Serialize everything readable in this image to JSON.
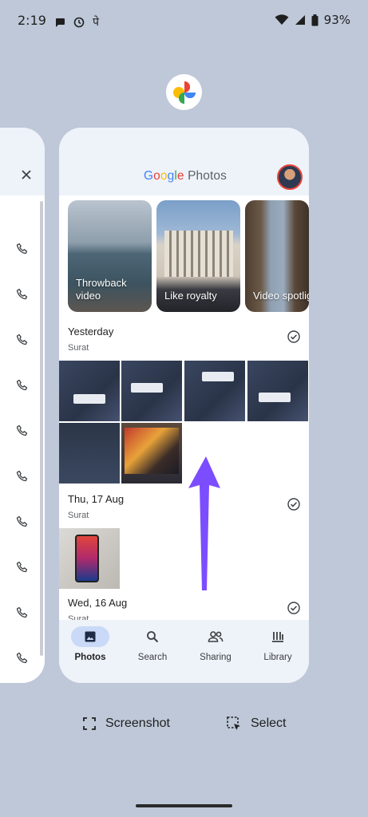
{
  "status_bar": {
    "time": "2:19",
    "battery": "93%",
    "icons": [
      "chat-bubble-icon",
      "clock-icon",
      "devanagari-pe-glyph",
      "wifi-icon",
      "signal-icon",
      "battery-icon"
    ],
    "devanagari_glyph": "पे"
  },
  "recents": {
    "app_icon": "google-photos-pinwheel-icon",
    "left_card": {
      "close_icon": "close-icon",
      "phone_icon_count": 10
    }
  },
  "photos_app": {
    "logo_brand": "Google",
    "logo_product": " Photos",
    "brand_colors": [
      "#4285F4",
      "#EA4335",
      "#FBBC05",
      "#4285F4",
      "#34A853",
      "#EA4335"
    ],
    "memories": [
      {
        "label": "Throwback video"
      },
      {
        "label": "Like royalty"
      },
      {
        "label": "Video spotlight"
      }
    ],
    "sections": [
      {
        "date": "Yesterday",
        "place": "Surat"
      },
      {
        "date": "Thu, 17 Aug",
        "place": "Surat"
      },
      {
        "date": "Wed, 16 Aug",
        "place": "Surat"
      }
    ],
    "nav": {
      "items": [
        {
          "label": "Photos",
          "icon": "photo-icon",
          "active": true
        },
        {
          "label": "Search",
          "icon": "search-icon",
          "active": false
        },
        {
          "label": "Sharing",
          "icon": "people-icon",
          "active": false
        },
        {
          "label": "Library",
          "icon": "library-icon",
          "active": false
        }
      ]
    },
    "active_nav_color": "#c9d9f7"
  },
  "annotation": {
    "arrow_color": "#7c4dff",
    "arrow_direction": "up"
  },
  "actions": {
    "screenshot_label": "Screenshot",
    "select_label": "Select"
  }
}
